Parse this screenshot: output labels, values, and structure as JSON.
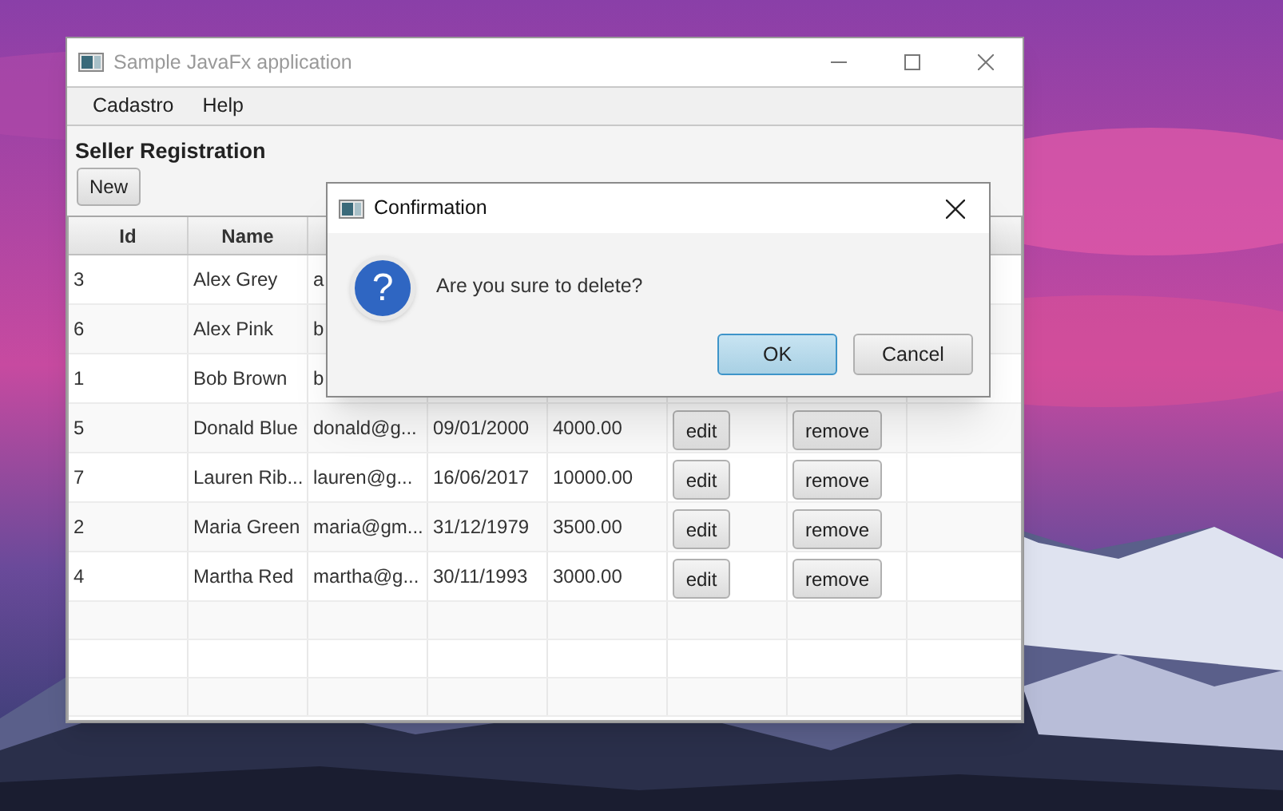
{
  "window": {
    "title": "Sample JavaFx application"
  },
  "menu": [
    "Cadastro",
    "Help"
  ],
  "heading": "Seller Registration",
  "new_button": "New",
  "table": {
    "columns": [
      "Id",
      "Name"
    ],
    "rows": [
      {
        "id": "3",
        "name": "Alex Grey",
        "email": "a"
      },
      {
        "id": "6",
        "name": "Alex Pink",
        "email": "b"
      },
      {
        "id": "1",
        "name": "Bob Brown",
        "email": "b"
      },
      {
        "id": "5",
        "name": "Donald Blue",
        "email": "donald@g...",
        "birth_date": "09/01/2000",
        "base_salary": "4000.00",
        "edit": "edit",
        "remove": "remove"
      },
      {
        "id": "7",
        "name": "Lauren Rib...",
        "email": "lauren@g...",
        "birth_date": "16/06/2017",
        "base_salary": "10000.00",
        "edit": "edit",
        "remove": "remove"
      },
      {
        "id": "2",
        "name": "Maria Green",
        "email": "maria@gm...",
        "birth_date": "31/12/1979",
        "base_salary": "3500.00",
        "edit": "edit",
        "remove": "remove"
      },
      {
        "id": "4",
        "name": "Martha Red",
        "email": "martha@g...",
        "birth_date": "30/11/1993",
        "base_salary": "3000.00",
        "edit": "edit",
        "remove": "remove"
      }
    ]
  },
  "dialog": {
    "title": "Confirmation",
    "icon_glyph": "?",
    "message": "Are you sure to delete?",
    "buttons": [
      {
        "label": "OK",
        "default": true
      },
      {
        "label": "Cancel",
        "default": false
      }
    ]
  }
}
